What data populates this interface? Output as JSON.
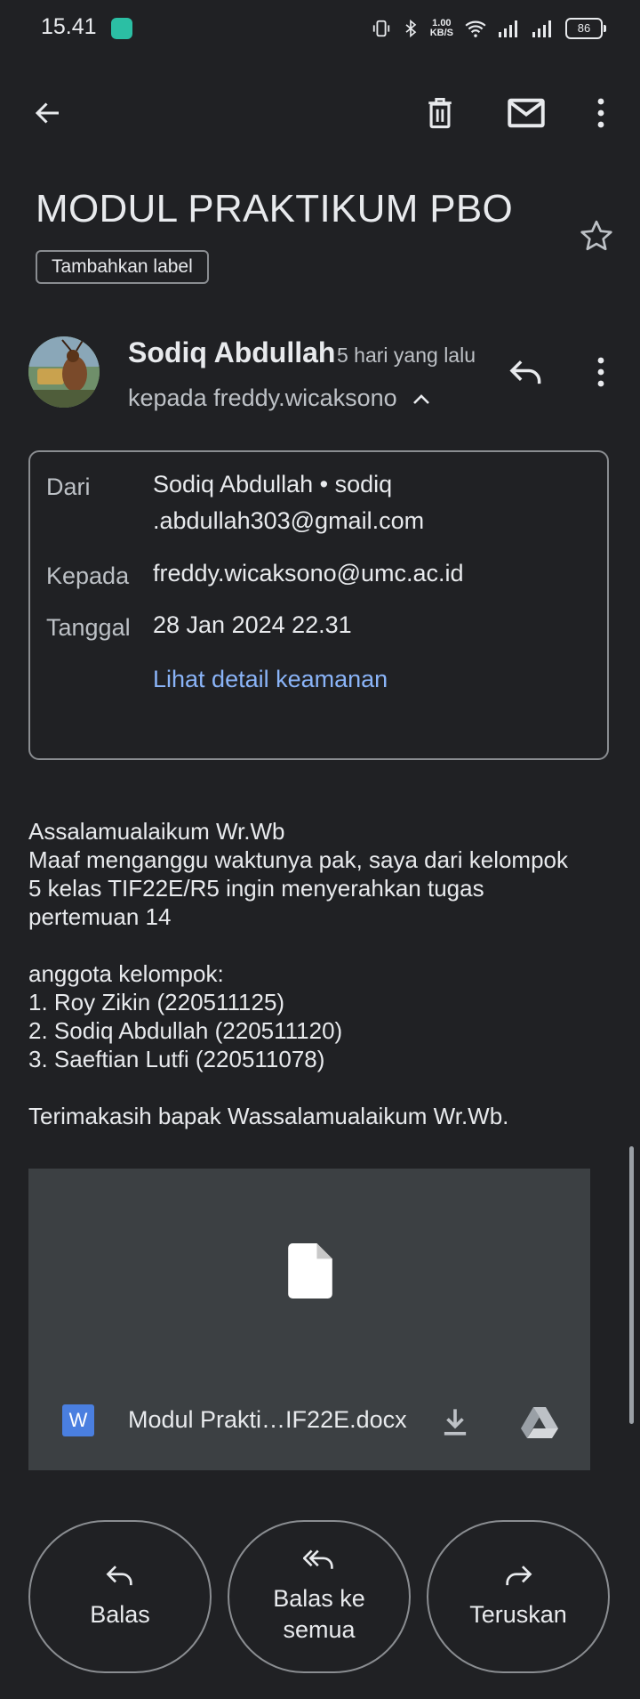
{
  "status_bar": {
    "time": "15.41",
    "net_speed_value": "1.00",
    "net_speed_unit": "KB/S",
    "battery": "86"
  },
  "toolbar": {
    "back_icon": "arrow-left-icon",
    "delete_icon": "trash-icon",
    "mark_unread_icon": "mail-icon",
    "more_icon": "more-vert-icon"
  },
  "email": {
    "subject": "MODUL PRAKTIKUM PBO",
    "add_label": "Tambahkan label",
    "sender_name": "Sodiq Abdullah",
    "sent_ago": "5 hari yang lalu",
    "to_summary": "kepada freddy.wicaksono",
    "details": {
      "from_label": "Dari",
      "from_value_line1": "Sodiq Abdullah • sodiq",
      "from_value_line2": ".abdullah303@gmail.com",
      "to_label": "Kepada",
      "to_value": "freddy.wicaksono@umc.ac.id",
      "date_label": "Tanggal",
      "date_value": "28 Jan 2024 22.31",
      "security_link": "Lihat detail keamanan"
    },
    "body": "Assalamualaikum Wr.Wb\nMaaf menganggu waktunya pak, saya dari kelompok\n5 kelas TIF22E/R5 ingin menyerahkan tugas\npertemuan 14\n\nanggota kelompok:\n1. Roy Zikin (220511125)\n2. Sodiq Abdullah (220511120)\n3. Saeftian Lutfi (220511078)\n\nTerimakasih bapak Wassalamualaikum Wr.Wb.",
    "attachment": {
      "file_type_badge": "W",
      "name": "Modul Prakti…IF22E.docx"
    }
  },
  "actions": {
    "reply": "Balas",
    "reply_all_line1": "Balas ke",
    "reply_all_line2": "semua",
    "forward": "Teruskan"
  },
  "colors": {
    "background": "#202124",
    "link": "#8ab4f8",
    "attachment_bg": "#3c4043",
    "word_blue": "#4a7fe0"
  }
}
